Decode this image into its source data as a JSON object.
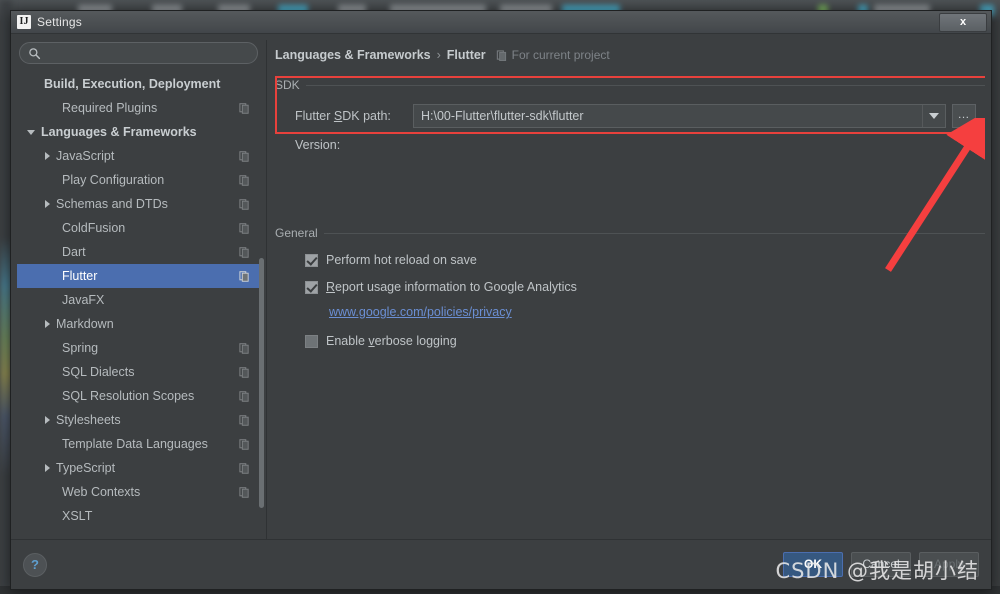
{
  "window": {
    "title": "Settings",
    "icon": "intellij-logo-icon",
    "close_label": "x"
  },
  "search": {
    "value": "",
    "placeholder": "",
    "icon": "search-icon"
  },
  "sidebar": {
    "items": [
      {
        "label": "Build, Execution, Deployment",
        "indent": 0,
        "arrow": "none",
        "bold": true,
        "selected": false,
        "config_icon": false
      },
      {
        "label": "Required Plugins",
        "indent": 1,
        "arrow": "none",
        "bold": false,
        "selected": false,
        "config_icon": true
      },
      {
        "label": "Languages & Frameworks",
        "indent": 0,
        "arrow": "down",
        "bold": true,
        "selected": false,
        "config_icon": false
      },
      {
        "label": "JavaScript",
        "indent": 1,
        "arrow": "right",
        "bold": false,
        "selected": false,
        "config_icon": true
      },
      {
        "label": "Play Configuration",
        "indent": 1,
        "arrow": "none",
        "bold": false,
        "selected": false,
        "config_icon": true
      },
      {
        "label": "Schemas and DTDs",
        "indent": 1,
        "arrow": "right",
        "bold": false,
        "selected": false,
        "config_icon": true
      },
      {
        "label": "ColdFusion",
        "indent": 1,
        "arrow": "none",
        "bold": false,
        "selected": false,
        "config_icon": true
      },
      {
        "label": "Dart",
        "indent": 1,
        "arrow": "none",
        "bold": false,
        "selected": false,
        "config_icon": true
      },
      {
        "label": "Flutter",
        "indent": 1,
        "arrow": "none",
        "bold": false,
        "selected": true,
        "config_icon": true
      },
      {
        "label": "JavaFX",
        "indent": 1,
        "arrow": "none",
        "bold": false,
        "selected": false,
        "config_icon": false
      },
      {
        "label": "Markdown",
        "indent": 1,
        "arrow": "right",
        "bold": false,
        "selected": false,
        "config_icon": false
      },
      {
        "label": "Spring",
        "indent": 1,
        "arrow": "none",
        "bold": false,
        "selected": false,
        "config_icon": true
      },
      {
        "label": "SQL Dialects",
        "indent": 1,
        "arrow": "none",
        "bold": false,
        "selected": false,
        "config_icon": true
      },
      {
        "label": "SQL Resolution Scopes",
        "indent": 1,
        "arrow": "none",
        "bold": false,
        "selected": false,
        "config_icon": true
      },
      {
        "label": "Stylesheets",
        "indent": 1,
        "arrow": "right",
        "bold": false,
        "selected": false,
        "config_icon": true
      },
      {
        "label": "Template Data Languages",
        "indent": 1,
        "arrow": "none",
        "bold": false,
        "selected": false,
        "config_icon": true
      },
      {
        "label": "TypeScript",
        "indent": 1,
        "arrow": "right",
        "bold": false,
        "selected": false,
        "config_icon": true
      },
      {
        "label": "Web Contexts",
        "indent": 1,
        "arrow": "none",
        "bold": false,
        "selected": false,
        "config_icon": true
      },
      {
        "label": "XSLT",
        "indent": 1,
        "arrow": "none",
        "bold": false,
        "selected": false,
        "config_icon": false
      }
    ]
  },
  "breadcrumb": {
    "parent": "Languages & Frameworks",
    "separator": "›",
    "current": "Flutter",
    "scope_icon": "project-scope-icon",
    "scope_text": "For current project"
  },
  "sdk_section": {
    "title": "SDK",
    "path_label_pre": "Flutter ",
    "path_label_mnemonic": "S",
    "path_label_post": "DK path:",
    "path_value": "H:\\00-Flutter\\flutter-sdk\\flutter",
    "dropdown_icon": "chevron-down-icon",
    "browse_label": "…",
    "version_label": "Version:"
  },
  "general_section": {
    "title": "General",
    "checkboxes": [
      {
        "label_pre": "Perform hot reload on save",
        "mnemonic": "",
        "label_post": "",
        "checked": true
      },
      {
        "label_pre": "",
        "mnemonic": "R",
        "label_post": "eport usage information to Google Analytics",
        "checked": true
      },
      {
        "label_pre": "Enable ",
        "mnemonic": "v",
        "label_post": "erbose logging",
        "checked": false
      }
    ],
    "privacy_link": "www.google.com/policies/privacy"
  },
  "footer": {
    "help_label": "?",
    "buttons": [
      {
        "label": "OK",
        "style": "primary"
      },
      {
        "label": "Cancel",
        "style": "normal"
      },
      {
        "label": "Apply",
        "style": "disabled"
      }
    ]
  },
  "watermark": "CSDN @我是胡小结",
  "colors": {
    "accent": "#4b6eaf",
    "annotation": "#e8413c",
    "link": "#6b8fd4",
    "panel": "#3c3f41"
  }
}
